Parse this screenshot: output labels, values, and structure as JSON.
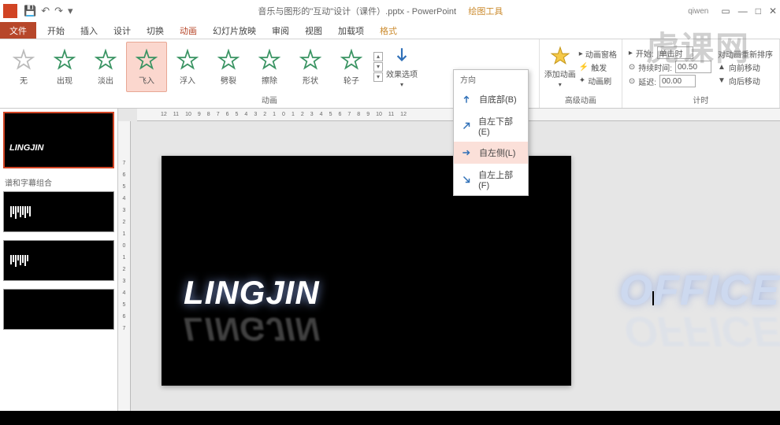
{
  "titlebar": {
    "filename": "音乐与图形的\"互动\"设计（课件）.pptx - PowerPoint",
    "context_tools": "绘图工具",
    "user": "qiwen"
  },
  "tabs": {
    "file": "文件",
    "items": [
      "开始",
      "插入",
      "设计",
      "切换",
      "动画",
      "幻灯片放映",
      "审阅",
      "视图",
      "加载项"
    ],
    "context": "格式",
    "active": "动画"
  },
  "animations": {
    "group_label": "动画",
    "items": [
      {
        "name": "无",
        "label": "无"
      },
      {
        "name": "出现",
        "label": "出现"
      },
      {
        "name": "淡出",
        "label": "淡出"
      },
      {
        "name": "飞入",
        "label": "飞入",
        "selected": true
      },
      {
        "name": "浮入",
        "label": "浮入"
      },
      {
        "name": "劈裂",
        "label": "劈裂"
      },
      {
        "name": "擦除",
        "label": "擦除"
      },
      {
        "name": "形状",
        "label": "形状"
      },
      {
        "name": "轮子",
        "label": "轮子"
      }
    ],
    "effect_options": "效果选项"
  },
  "advanced": {
    "group_label": "高级动画",
    "add": "添加动画",
    "trigger": "触发",
    "pane": "动画窗格",
    "painter": "动画刷"
  },
  "timing": {
    "group_label": "计时",
    "start_label": "开始:",
    "start_value": "单击时",
    "duration_label": "持续时间:",
    "duration_value": "00.50",
    "delay_label": "延迟:",
    "delay_value": "00.00",
    "reorder": "对动画重新排序",
    "move_earlier": "向前移动",
    "move_later": "向后移动"
  },
  "dropdown": {
    "header": "方向",
    "items": [
      {
        "icon": "↑",
        "label": "自底部(B)"
      },
      {
        "icon": "↗",
        "label": "自左下部(E)"
      },
      {
        "icon": "→",
        "label": "自左侧(L)",
        "hover": true
      },
      {
        "icon": "↘",
        "label": "自左上部(F)"
      }
    ]
  },
  "ruler_h": [
    "12",
    "11",
    "10",
    "9",
    "8",
    "7",
    "6",
    "5",
    "4",
    "3",
    "2",
    "1",
    "0",
    "1",
    "2",
    "3",
    "4",
    "5",
    "6",
    "7",
    "8",
    "9",
    "10",
    "11",
    "12"
  ],
  "ruler_v": [
    "7",
    "6",
    "5",
    "4",
    "3",
    "2",
    "1",
    "0",
    "1",
    "2",
    "3",
    "4",
    "5",
    "6",
    "7"
  ],
  "slide": {
    "text1": "LINGJIN"
  },
  "thumbs": {
    "title1": "LINGJIN",
    "section": "谱和字幕组合"
  },
  "watermark": {
    "office": "OFFICE",
    "brand": "虎课网"
  }
}
